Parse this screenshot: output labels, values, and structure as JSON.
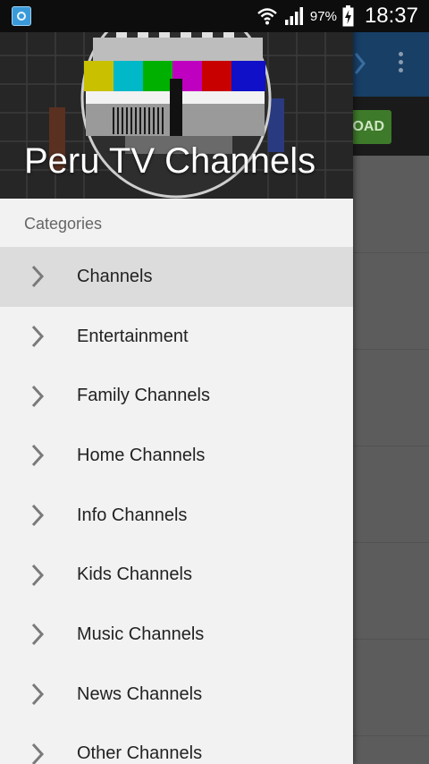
{
  "status_bar": {
    "battery": "97%",
    "time": "18:37",
    "icons": [
      "app-notification-icon",
      "wifi-icon",
      "signal-icon",
      "battery-charging-icon"
    ]
  },
  "background_app": {
    "load_button_label": "OAD"
  },
  "drawer": {
    "title": "Peru TV Channels",
    "section_label": "Categories",
    "items": [
      {
        "label": "Channels",
        "selected": true
      },
      {
        "label": "Entertainment"
      },
      {
        "label": "Family Channels"
      },
      {
        "label": "Home Channels"
      },
      {
        "label": "Info Channels"
      },
      {
        "label": "Kids Channels"
      },
      {
        "label": "Music Channels"
      },
      {
        "label": "News Channels"
      },
      {
        "label": "Other Channels"
      }
    ],
    "item_icon": "chevron-right-icon"
  },
  "colors": {
    "status_bar": "#0d0d0d",
    "toolbar": "#183f66",
    "drawer_bg": "#f2f2f2",
    "selected_item": "#dcdcdc",
    "load_button": "#3d7a2a"
  }
}
